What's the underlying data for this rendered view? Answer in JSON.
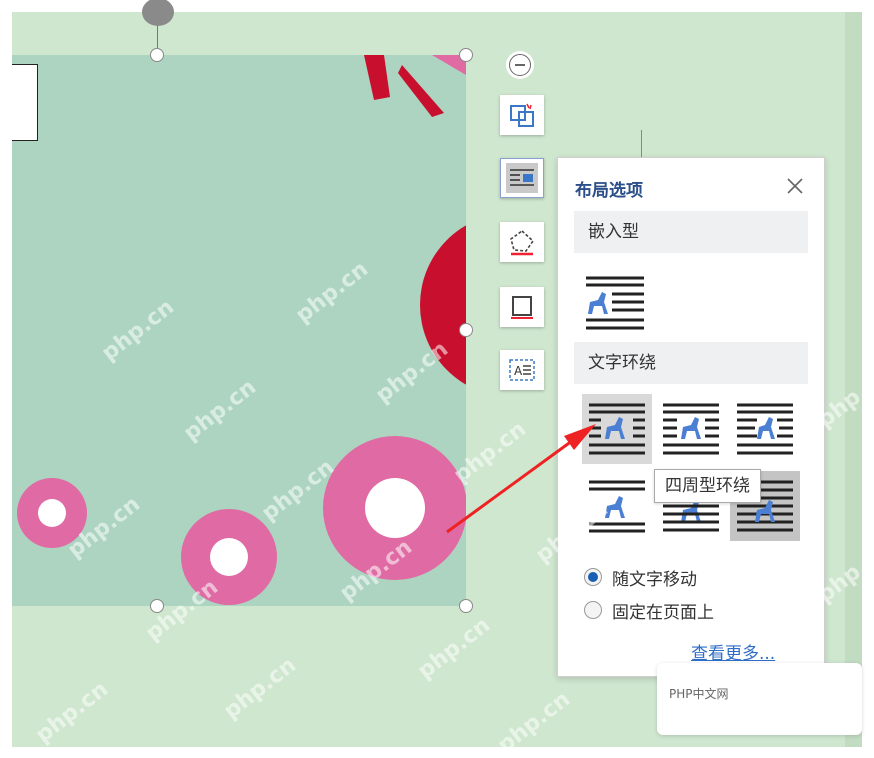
{
  "colors": {
    "page_bg": "#cfe6cf",
    "image_bg": "#acd4c0",
    "pink": "#e06aa3",
    "red": "#c8102e",
    "accent_link": "#2f6ec7",
    "arrow": "#ee2222"
  },
  "side_toolbar": [
    {
      "name": "zoom-out",
      "icon": "minus-circle-icon"
    },
    {
      "name": "crop-link",
      "icon": "link-crop-icon"
    },
    {
      "name": "layout-options",
      "icon": "text-wrap-icon",
      "selected": true
    },
    {
      "name": "shape-cutout",
      "icon": "shape-edit-icon"
    },
    {
      "name": "border",
      "icon": "frame-icon"
    },
    {
      "name": "image-text",
      "icon": "ocr-text-icon"
    }
  ],
  "layout_panel": {
    "title": "布局选项",
    "inline_section": "嵌入型",
    "wrap_section": "文字环绕",
    "tooltip": "四周型环绕",
    "radio_move": "随文字移动",
    "radio_fixed": "固定在页面上",
    "radio_selected": "move",
    "more_link": "查看更多..."
  },
  "corner_box_text": "PHP中文网",
  "watermark": "php.cn"
}
